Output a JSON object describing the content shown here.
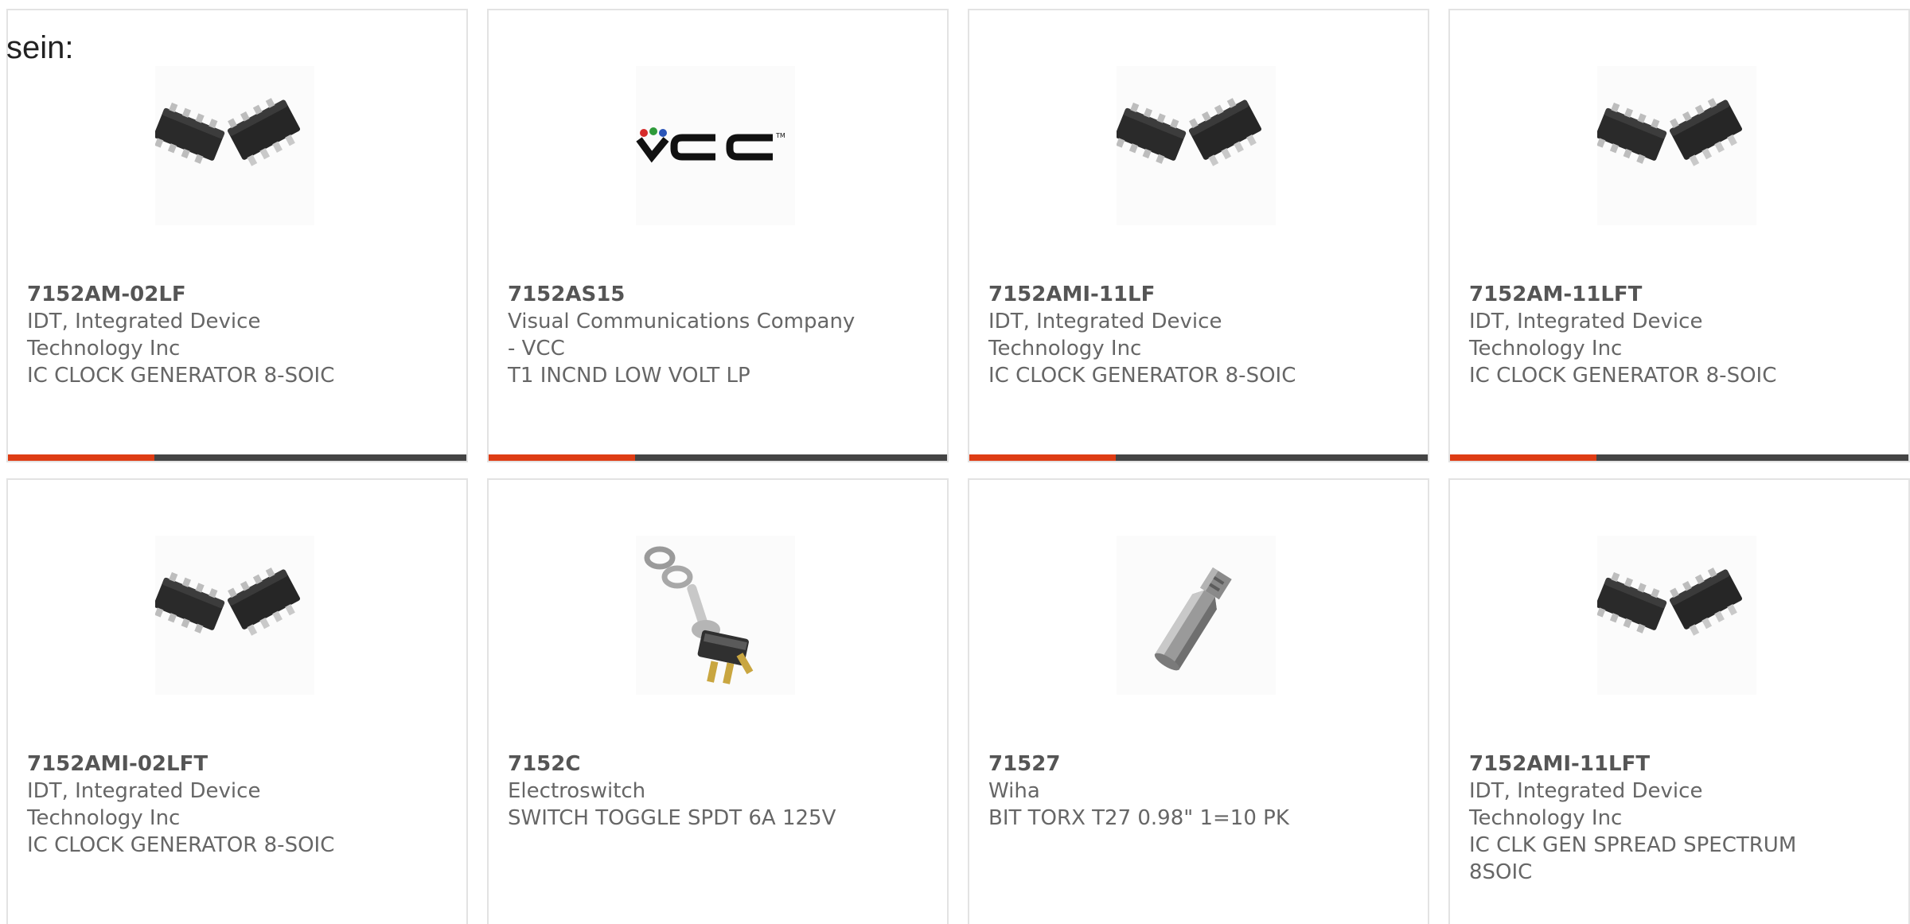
{
  "intro_text": "sein:",
  "colors": {
    "accent": "#de3c14",
    "bar": "#444444",
    "card_border": "#e3e3e3"
  },
  "cards": [
    {
      "part": "7152AM-02LF",
      "manufacturer": "IDT, Integrated Device Technology Inc",
      "description": "IC CLOCK GENERATOR 8-SOIC",
      "image": "soic-chip-image"
    },
    {
      "part": "7152AS15",
      "manufacturer": "Visual Communications Company - VCC",
      "description": "T1 INCND LOW VOLT LP",
      "image": "vcc-logo"
    },
    {
      "part": "7152AMI-11LF",
      "manufacturer": "IDT, Integrated Device Technology Inc",
      "description": "IC CLOCK GENERATOR 8-SOIC",
      "image": "soic-chip-image"
    },
    {
      "part": "7152AM-11LFT",
      "manufacturer": "IDT, Integrated Device Technology Inc",
      "description": "IC CLOCK GENERATOR 8-SOIC",
      "image": "soic-chip-image"
    },
    {
      "part": "7152AMI-02LFT",
      "manufacturer": "IDT, Integrated Device Technology Inc",
      "description": "IC CLOCK GENERATOR 8-SOIC",
      "image": "soic-chip-image"
    },
    {
      "part": "7152C",
      "manufacturer": "Electroswitch",
      "description": "SWITCH TOGGLE SPDT 6A 125V",
      "image": "toggle-switch-image"
    },
    {
      "part": "71527",
      "manufacturer": "Wiha",
      "description": "BIT TORX T27 0.98\" 1=10 PK",
      "image": "torx-bit-image"
    },
    {
      "part": "7152AMI-11LFT",
      "manufacturer": "IDT, Integrated Device Technology Inc",
      "description": "IC CLK GEN SPREAD SPECTRUM 8SOIC",
      "image": "soic-chip-image"
    }
  ]
}
